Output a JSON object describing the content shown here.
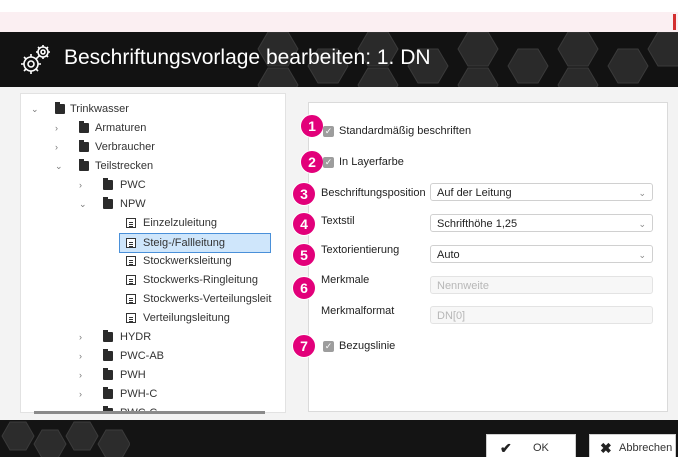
{
  "dialog": {
    "title": "Beschriftungsvorlage bearbeiten: 1. DN"
  },
  "tree": {
    "root": "Trinkwasser",
    "armaturen": "Armaturen",
    "verbraucher": "Verbraucher",
    "teilstrecken": "Teilstrecken",
    "pwc": "PWC",
    "npw": "NPW",
    "einzelzuleitung": "Einzelzuleitung",
    "steig": "Steig-/Fallleitung",
    "stockwerksleitung": "Stockwerksleitung",
    "ringleitung": "Stockwerks-Ringleitung",
    "verteilungsleit": "Stockwerks-Verteilungsleit",
    "verteilungsleitung": "Verteilungsleitung",
    "hydr": "HYDR",
    "pwcab": "PWC-AB",
    "pwh": "PWH",
    "pwhc": "PWH-C",
    "cut": "PWC-C"
  },
  "form": {
    "n1": "1",
    "n2": "2",
    "n3": "3",
    "n4": "4",
    "n5": "5",
    "n6": "6",
    "n7": "7",
    "standard_label": "Standardmäßig beschriften",
    "layerfarbe_label": "In Layerfarbe",
    "position_label": "Beschriftungsposition",
    "position_value": "Auf der Leitung",
    "textstil_label": "Textstil",
    "textstil_value": "Schrifthöhe 1,25",
    "orientierung_label": "Textorientierung",
    "orientierung_value": "Auto",
    "merkmale_label": "Merkmale",
    "merkmale_value": "Nennweite",
    "merkmalformat_label": "Merkmalformat",
    "merkmalformat_value": "DN[0]",
    "bezugslinie_label": "Bezugslinie"
  },
  "footer": {
    "ok_label": "OK",
    "cancel_label": "Abbrechen"
  },
  "colors": {
    "accent": "#e2007a",
    "header_bg": "#121212",
    "selection": "#cfe6fb"
  }
}
